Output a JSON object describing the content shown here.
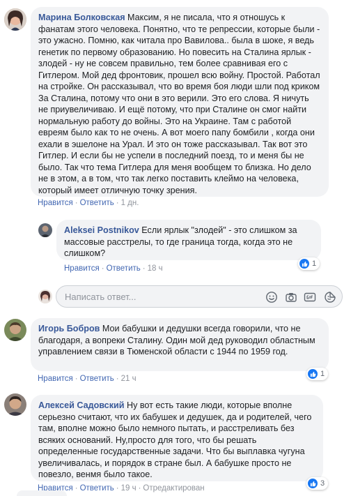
{
  "comments": [
    {
      "author": "Марина Болковская",
      "text": "Максим, я не писала, что я отношусь к фанатам этого человека. Понятно, что те репрессии, которые были - это ужасно. Помню, как читала про Вавилова.. была в шоке, я ведь генетик по первому образованию. Но повесить на Сталина ярлык - злодей - ну не совсем правильно, тем более сравнивая его с Гитлером. Мой дед фронтовик, прошел всю войну. Простой. Работал на стройке. Он рассказывал, что во время боя люди шли под криком За Сталина, потому что они в это верили. Это его слова. Я ничуть не приувеличиваю. И ещё потому, что при Сталине он смог найти нормальную работу до войны. Это на Украине. Там с работой евреям было как то не очень. А вот моего папу бомбили , когда они ехали в эшелоне на Урал. И это он тоже рассказывал. Так вот это Гитлер. И если бы не успели в последний поезд, то и меня бы не было. Так что тема Гитлера для меня вообщем то близка. Но дело не в этом, а в том, что так легко поставить клеймо на человека, который имеет отличную точку зрения.",
      "like_label": "Нравится",
      "reply_label": "Ответить",
      "time": "1 дн."
    },
    {
      "author": "Aleksei Postnikov",
      "text": "Если ярлык \"злодей\" - это слишком за массовые расстрелы, то где граница тогда, когда это не слишком?",
      "like_label": "Нравится",
      "reply_label": "Ответить",
      "time": "18 ч",
      "reaction_count": "1"
    },
    {
      "author": "Игорь Бобров",
      "text": "Мои бабушки и дедушки всегда говорили, что не благодаря, а вопреки Сталину. Один мой дед руководил областным управлением связи в Тюменской области с 1944 по 1959 год.",
      "like_label": "Нравится",
      "reply_label": "Ответить",
      "time": "21 ч",
      "reaction_count": "1"
    },
    {
      "author": "Алексей Садовский",
      "text": "Ну вот есть такие люди, которые вполне серьезно считают, что их бабушек и дедушек, да и родителей, чего там, вполне можно было немного пытать, и расстреливать без всяких оснований. Ну,просто для того, что бы решать определенные государственные задачи. Что бы выплавка чугуна увеличивалась, и порядок в стране был. А бабушке просто не повезло, венмя было такое.",
      "like_label": "Нравится",
      "reply_label": "Ответить",
      "time": "19 ч",
      "edited": "Отредактирован",
      "reaction_count": "3"
    }
  ],
  "reply_box": {
    "placeholder": "Написать ответ...",
    "icons": [
      "emoji-icon",
      "camera-icon",
      "gif-icon",
      "sticker-icon"
    ]
  },
  "colors": {
    "author": "#385898",
    "link": "#4267b2",
    "muted": "#90949c",
    "bubble": "#f2f3f5",
    "like": "#1877f2"
  }
}
